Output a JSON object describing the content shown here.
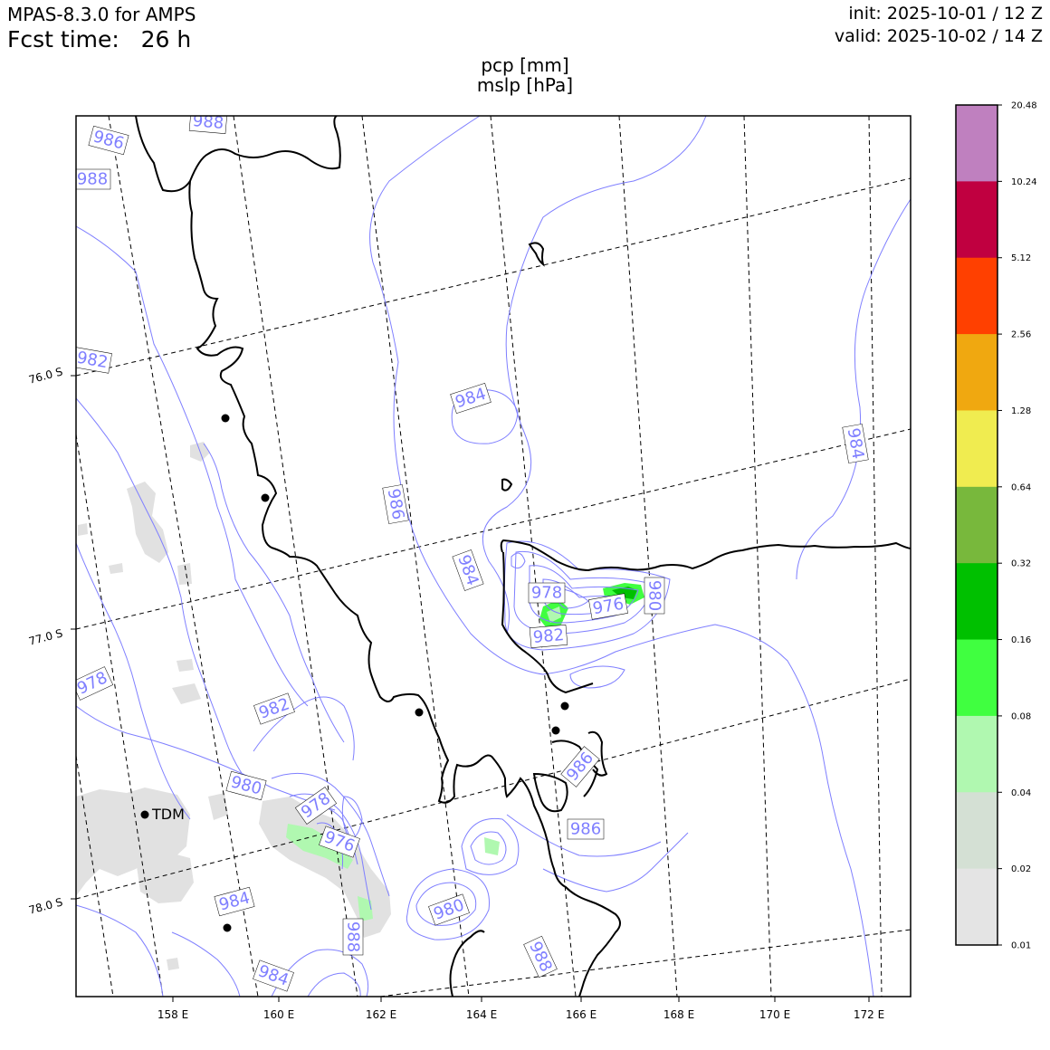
{
  "header": {
    "model": "MPAS-8.3.0 for AMPS",
    "forecast_label": "Fcst time:",
    "forecast_hours": "26 h",
    "init": "init: 2025-10-01 / 12 Z",
    "valid": "valid: 2025-10-02 / 14 Z"
  },
  "title": {
    "line1": "pcp [mm]",
    "line2": "mslp [hPa]"
  },
  "map": {
    "lon_ticks": [
      "158 E",
      "160 E",
      "162 E",
      "164 E",
      "166 E",
      "168 E",
      "170 E",
      "172 E"
    ],
    "lat_ticks": [
      "76.0 S",
      "77.0 S",
      "78.0 S"
    ],
    "station_label": "TDM",
    "isobar_labels": [
      "986",
      "988",
      "988",
      "982",
      "984",
      "986",
      "984",
      "984",
      "978",
      "976",
      "980",
      "982",
      "978",
      "982",
      "980",
      "978",
      "976",
      "986",
      "986",
      "984",
      "980",
      "988",
      "988",
      "984"
    ],
    "coastline_color": "#000000",
    "isobar_color": "#7f7fff",
    "graticule_style": "dashed"
  },
  "colorbar": {
    "ticks": [
      "20.48",
      "10.24",
      "5.12",
      "2.56",
      "1.28",
      "0.64",
      "0.32",
      "0.16",
      "0.08",
      "0.04",
      "0.02",
      "0.01"
    ],
    "colors": [
      "#bf80bf",
      "#c00040",
      "#ff4000",
      "#f0a810",
      "#f0ec50",
      "#78b83c",
      "#00c000",
      "#40ff40",
      "#b0f8b0",
      "#d4e0d4",
      "#e4e4e4"
    ]
  }
}
